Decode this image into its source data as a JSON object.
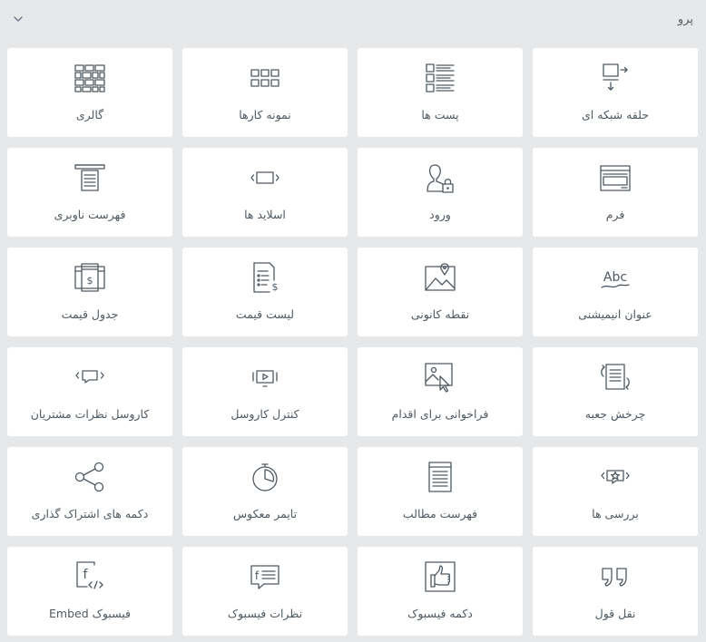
{
  "section": {
    "title": "پرو",
    "toggle_icon": "chevron-down-icon"
  },
  "widgets": [
    {
      "label": "حلقه شبکه ای",
      "icon": "loop-grid-icon"
    },
    {
      "label": "پست ها",
      "icon": "posts-icon"
    },
    {
      "label": "نمونه کارها",
      "icon": "portfolio-icon"
    },
    {
      "label": "گالری",
      "icon": "gallery-icon"
    },
    {
      "label": "فرم",
      "icon": "form-icon"
    },
    {
      "label": "ورود",
      "icon": "login-icon"
    },
    {
      "label": "اسلاید ها",
      "icon": "slides-icon"
    },
    {
      "label": "فهرست ناوبری",
      "icon": "nav-menu-icon"
    },
    {
      "label": "عنوان انیمیشنی",
      "icon": "animated-headline-icon"
    },
    {
      "label": "نقطه کانونی",
      "icon": "hotspot-icon"
    },
    {
      "label": "لیست قیمت",
      "icon": "price-list-icon"
    },
    {
      "label": "جدول قیمت",
      "icon": "price-table-icon"
    },
    {
      "label": "چرخش جعبه",
      "icon": "flip-box-icon"
    },
    {
      "label": "فراخوانی برای اقدام",
      "icon": "call-to-action-icon"
    },
    {
      "label": "کنترل کاروسل",
      "icon": "media-carousel-icon"
    },
    {
      "label": "کاروسل نظرات مشتریان",
      "icon": "testimonial-carousel-icon"
    },
    {
      "label": "بررسی ها",
      "icon": "reviews-icon"
    },
    {
      "label": "فهرست مطالب",
      "icon": "table-of-contents-icon"
    },
    {
      "label": "تایمر معکوس",
      "icon": "countdown-icon"
    },
    {
      "label": "دکمه های اشتراک گذاری",
      "icon": "share-buttons-icon"
    },
    {
      "label": "نقل قول",
      "icon": "blockquote-icon"
    },
    {
      "label": "دکمه فیسبوک",
      "icon": "facebook-button-icon"
    },
    {
      "label": "نظرات فیسبوک",
      "icon": "facebook-comments-icon"
    },
    {
      "label": "فیسبوک Embed",
      "icon": "facebook-embed-icon"
    }
  ]
}
